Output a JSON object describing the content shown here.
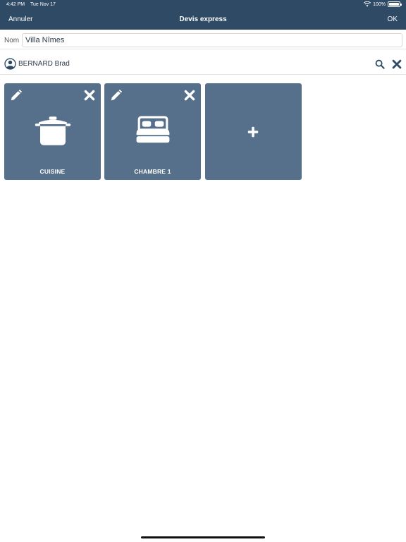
{
  "status_bar": {
    "time": "4:42 PM",
    "date": "Tue Nov 17",
    "battery": "100%"
  },
  "nav": {
    "cancel_label": "Annuler",
    "title": "Devis express",
    "ok_label": "OK"
  },
  "form": {
    "name_label": "Nom",
    "name_value": "Villa Nîmes"
  },
  "client": {
    "name": "BERNARD Brad"
  },
  "rooms": [
    {
      "label": "CUISINE",
      "icon": "cooking-pot-icon"
    },
    {
      "label": "CHAMBRE 1",
      "icon": "bed-icon"
    }
  ],
  "add_room": {
    "icon": "plus-icon"
  },
  "colors": {
    "header": "#2f4a64",
    "tile": "#56708b",
    "icon_dark": "#2f4a64"
  }
}
